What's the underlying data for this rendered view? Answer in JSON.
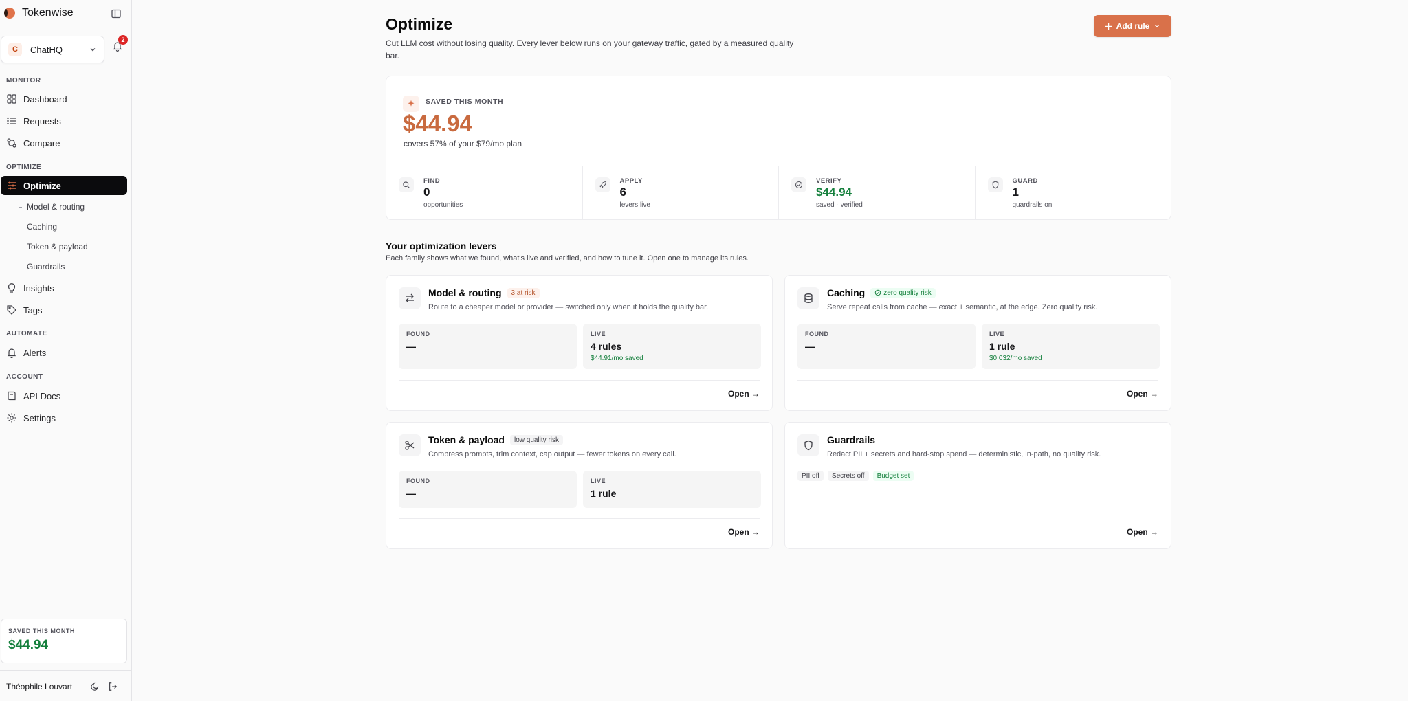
{
  "app": {
    "name": "Tokenwise"
  },
  "workspace": {
    "initial": "C",
    "name": "ChatHQ"
  },
  "notifications": {
    "count": "2"
  },
  "sidebar": {
    "sections": {
      "monitor": "MONITOR",
      "optimize": "OPTIMIZE",
      "automate": "AUTOMATE",
      "account": "ACCOUNT"
    },
    "items": {
      "dashboard": "Dashboard",
      "requests": "Requests",
      "compare": "Compare",
      "optimize": "Optimize",
      "model_routing": "Model & routing",
      "caching": "Caching",
      "token_payload": "Token & payload",
      "guardrails": "Guardrails",
      "insights": "Insights",
      "tags": "Tags",
      "alerts": "Alerts",
      "api_docs": "API Docs",
      "settings": "Settings"
    },
    "saved": {
      "label": "SAVED THIS MONTH",
      "value": "$44.94"
    },
    "user": {
      "name": "Théophile Louvart"
    }
  },
  "header": {
    "title": "Optimize",
    "description": "Cut LLM cost without losing quality. Every lever below runs on your gateway traffic, gated by a measured quality bar.",
    "add_rule": "Add rule"
  },
  "hero": {
    "label": "SAVED THIS MONTH",
    "value": "$44.94",
    "subtitle": "covers 57% of your $79/mo plan",
    "stats": {
      "find": {
        "label": "FIND",
        "value": "0",
        "sub": "opportunities"
      },
      "apply": {
        "label": "APPLY",
        "value": "6",
        "sub": "levers live"
      },
      "verify": {
        "label": "VERIFY",
        "value": "$44.94",
        "sub": "saved · verified"
      },
      "guard": {
        "label": "GUARD",
        "value": "1",
        "sub": "guardrails on"
      }
    }
  },
  "levers_section": {
    "title": "Your optimization levers",
    "description": "Each family shows what we found, what's live and verified, and how to tune it. Open one to manage its rules."
  },
  "levers": {
    "model_routing": {
      "title": "Model & routing",
      "badge": "3 at risk",
      "description": "Route to a cheaper model or provider — switched only when it holds the quality bar.",
      "found_label": "FOUND",
      "found_value": "—",
      "live_label": "LIVE",
      "live_value": "4 rules",
      "live_saved": "$44.91/mo saved",
      "open": "Open →"
    },
    "caching": {
      "title": "Caching",
      "badge": "zero quality risk",
      "description": "Serve repeat calls from cache — exact + semantic, at the edge. Zero quality risk.",
      "found_label": "FOUND",
      "found_value": "—",
      "live_label": "LIVE",
      "live_value": "1 rule",
      "live_saved": "$0.032/mo saved",
      "open": "Open →"
    },
    "token_payload": {
      "title": "Token & payload",
      "badge": "low quality risk",
      "description": "Compress prompts, trim context, cap output — fewer tokens on every call.",
      "found_label": "FOUND",
      "found_value": "—",
      "live_label": "LIVE",
      "live_value": "1 rule",
      "open": "Open →"
    },
    "guardrails": {
      "title": "Guardrails",
      "description": "Redact PII + secrets and hard-stop spend — deterministic, in-path, no quality risk.",
      "chips": {
        "pii": "PII off",
        "secrets": "Secrets off",
        "budget": "Budget set"
      },
      "open": "Open →"
    }
  },
  "colors": {
    "accent": "#d9714a",
    "success": "#15803d",
    "active_nav": "#0b0b0d",
    "badge": "#dc2626"
  }
}
